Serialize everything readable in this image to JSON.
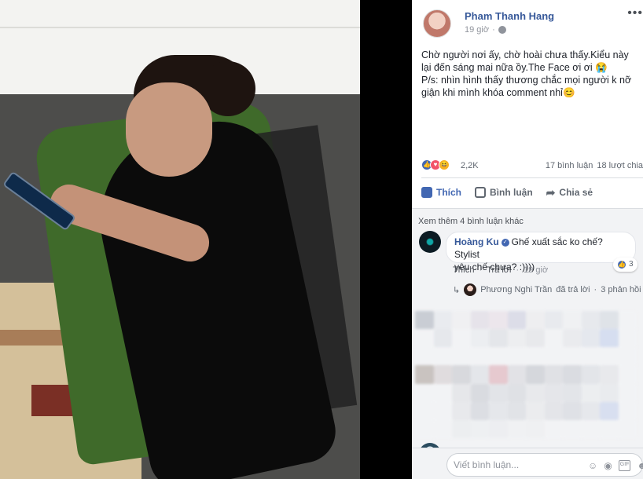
{
  "post": {
    "author": "Pham Thanh Hang",
    "time": "19 giờ",
    "text_lines": [
      "Chờ người nơi ấy, chờ hoài chưa thấy.Kiểu này",
      "lại đến sáng mai nữa ồy.The Face ơi ơi 😭",
      "P/s: nhìn hình thấy thương chắc mọi người k nỡ",
      "giận khi mình khóa comment nhỉ😊"
    ],
    "reaction_count": "2,2K",
    "comments_count": "17 bình luận",
    "shares_count": "18 lượt chia"
  },
  "actions": {
    "like": "Thích",
    "comment": "Bình luận",
    "share": "Chia sẻ"
  },
  "comments": {
    "see_more": "Xem thêm 4 bình luận khác",
    "first": {
      "author": "Hoàng Ku",
      "text_line1": "Ghế xuất sắc ko chế? Stylist",
      "text_line2": "yêu chế chưa? :))))",
      "likes": "3",
      "like_action": "Thích",
      "reply_action": "Trả lời",
      "time": "19 giờ"
    },
    "reply_summary": {
      "author": "Phương Nghi Trần",
      "text": "đã trả lời",
      "count": "3 phản hồi"
    }
  },
  "composer": {
    "placeholder": "Viết bình luận..."
  },
  "colors": {
    "link_blue": "#365899",
    "like_blue": "#4267b2",
    "muted": "#90949c",
    "panel_bg": "#f2f3f5"
  },
  "icons": [
    "globe-icon",
    "more-icon",
    "like-reaction-icon",
    "love-reaction-icon",
    "haha-reaction-icon",
    "like-icon",
    "comment-icon",
    "share-icon",
    "verified-icon",
    "reply-arrow-icon",
    "emoji-icon",
    "camera-icon",
    "gif-icon",
    "sticker-icon"
  ]
}
